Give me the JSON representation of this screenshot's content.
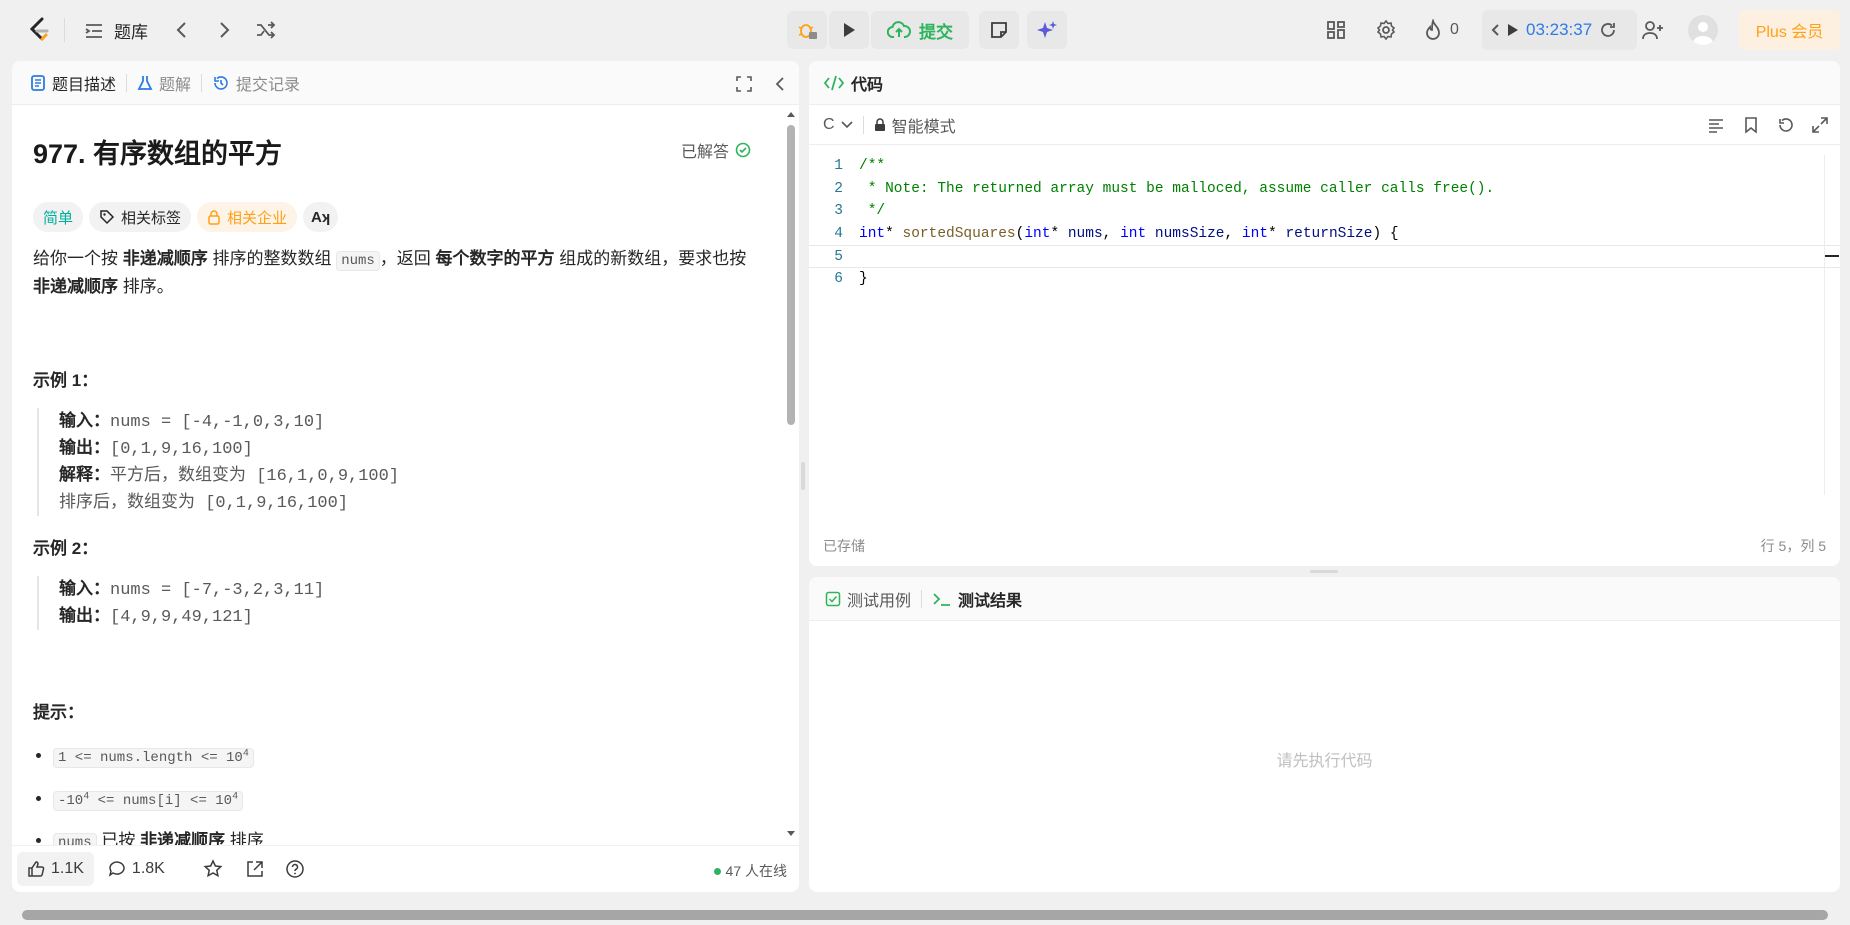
{
  "topbar": {
    "problem_list_label": "题库",
    "submit_label": "提交",
    "streak_count": "0",
    "timer": "03:23:37",
    "plus_label": "Plus 会员"
  },
  "left": {
    "tabs": [
      "题目描述",
      "题解",
      "提交记录"
    ],
    "title": "977. 有序数组的平方",
    "solved_label": "已解答",
    "tags": {
      "difficulty": "简单",
      "related_tags": "相关标签",
      "companies": "相关企业",
      "translate": "A文"
    },
    "desc": {
      "p1": "给你一个按 ",
      "b1": "非递减顺序",
      "p2": " 排序的整数数组 ",
      "code1": "nums",
      "p3": "，返回 ",
      "b2": "每个数字的平方",
      "p4": " 组成的新数组，要求也按 ",
      "b3": "非递减顺序",
      "p5": " 排序。"
    },
    "example1": {
      "heading": "示例 1：",
      "input_label": "输入：",
      "input": "nums = [-4,-1,0,3,10]",
      "output_label": "输出：",
      "output": "[0,1,9,16,100]",
      "explain_label": "解释：",
      "explain1": "平方后，数组变为 [16,1,0,9,100]",
      "explain2": "排序后，数组变为 [0,1,9,16,100]"
    },
    "example2": {
      "heading": "示例 2：",
      "input_label": "输入：",
      "input": "nums = [-7,-3,2,3,11]",
      "output_label": "输出：",
      "output": "[4,9,9,49,121]"
    },
    "hints": {
      "heading": "提示：",
      "h1_code": "1 <= nums.length <= 10",
      "h1_sup": "4",
      "h2_pre": "-10",
      "h2_sup1": "4",
      "h2_mid": " <= nums[i] <= 10",
      "h2_sup2": "4",
      "h3_code": "nums",
      "h3_text1": " 已按 ",
      "h3_bold": "非递减顺序",
      "h3_text2": " 排序"
    },
    "footer": {
      "likes": "1.1K",
      "comments": "1.8K",
      "online": "47 人在线"
    }
  },
  "editor": {
    "tab_label": "代码",
    "language": "C",
    "mode_label": "智能模式",
    "saved_label": "已存储",
    "cursor_pos": "行 5，列 5",
    "line_numbers": [
      "1",
      "2",
      "3",
      "4",
      "5",
      "6"
    ],
    "code": {
      "l1": "/**",
      "l2": " * Note: The returned array must be malloced, assume caller calls free().",
      "l3": " */",
      "l4_kw1": "int",
      "l4_p1": "* ",
      "l4_fn": "sortedSquares",
      "l4_p2": "(",
      "l4_kw2": "int",
      "l4_p3": "* ",
      "l4_id1": "nums",
      "l4_p4": ", ",
      "l4_kw3": "int",
      "l4_p5": " ",
      "l4_id2": "numsSize",
      "l4_p6": ", ",
      "l4_kw4": "int",
      "l4_p7": "* ",
      "l4_id3": "returnSize",
      "l4_p8": ") {",
      "l5": "",
      "l6": "}"
    }
  },
  "results": {
    "tabs": [
      "测试用例",
      "测试结果"
    ],
    "placeholder": "请先执行代码"
  }
}
